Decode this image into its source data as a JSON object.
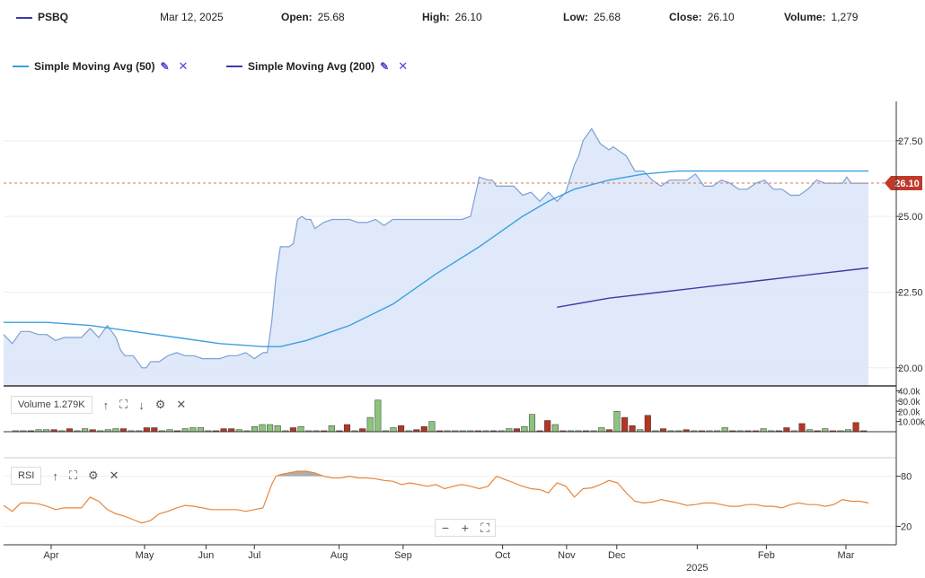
{
  "header": {
    "symbol": "PSBQ",
    "date": "Mar 12, 2025",
    "open_label": "Open:",
    "open_value": "25.68",
    "high_label": "High:",
    "high_value": "26.10",
    "low_label": "Low:",
    "low_value": "25.68",
    "close_label": "Close:",
    "close_value": "26.10",
    "volume_label": "Volume:",
    "volume_value": "1,279"
  },
  "legend": [
    {
      "label": "Simple Moving Avg (50)",
      "color": "#3aa0e0"
    },
    {
      "label": "Simple Moving Avg (200)",
      "color": "#3f3aa8"
    }
  ],
  "price_badge": "26.10",
  "volume_panel": {
    "label": "Volume 1.279K"
  },
  "rsi_panel": {
    "label": "RSI"
  },
  "colors": {
    "price_line": "#7f9fd6",
    "area_fill": "#dbe7f8",
    "sma50": "#3aa0e0",
    "sma200": "#3f3aa8",
    "up": "#8cc47c",
    "down": "#b73521",
    "rsi": "#e8863a",
    "badge": "#c0392b"
  },
  "chart_data": [
    {
      "type": "area",
      "title": "",
      "ylim": [
        19.4,
        28.8
      ],
      "y_ticks": [
        "20.00",
        "22.50",
        "25.00",
        "27.50"
      ],
      "x_ticks": [
        {
          "label": "Apr",
          "t": 0.055
        },
        {
          "label": "May",
          "t": 0.163
        },
        {
          "label": "Jun",
          "t": 0.234
        },
        {
          "label": "Jul",
          "t": 0.29
        },
        {
          "label": "Aug",
          "t": 0.388
        },
        {
          "label": "Sep",
          "t": 0.462
        },
        {
          "label": "Oct",
          "t": 0.577
        },
        {
          "label": "Nov",
          "t": 0.651
        },
        {
          "label": "Dec",
          "t": 0.709
        },
        {
          "label": "Feb",
          "t": 0.882
        },
        {
          "label": "Mar",
          "t": 0.974
        }
      ],
      "x_year_label": {
        "label": "2025",
        "t": 0.802
      },
      "reference_line": 26.1,
      "series": [
        {
          "name": "PSBQ",
          "t": [
            0,
            0.01,
            0.02,
            0.03,
            0.04,
            0.05,
            0.06,
            0.07,
            0.08,
            0.09,
            0.1,
            0.11,
            0.12,
            0.125,
            0.13,
            0.135,
            0.14,
            0.15,
            0.16,
            0.165,
            0.17,
            0.18,
            0.19,
            0.2,
            0.21,
            0.22,
            0.23,
            0.24,
            0.25,
            0.26,
            0.27,
            0.28,
            0.29,
            0.3,
            0.305,
            0.31,
            0.315,
            0.32,
            0.33,
            0.335,
            0.34,
            0.345,
            0.35,
            0.355,
            0.36,
            0.37,
            0.38,
            0.39,
            0.4,
            0.41,
            0.42,
            0.43,
            0.44,
            0.45,
            0.46,
            0.47,
            0.48,
            0.49,
            0.5,
            0.51,
            0.52,
            0.53,
            0.54,
            0.55,
            0.56,
            0.565,
            0.57,
            0.58,
            0.59,
            0.6,
            0.61,
            0.62,
            0.63,
            0.64,
            0.65,
            0.66,
            0.665,
            0.67,
            0.68,
            0.69,
            0.7,
            0.705,
            0.71,
            0.72,
            0.73,
            0.74,
            0.75,
            0.76,
            0.77,
            0.78,
            0.79,
            0.8,
            0.81,
            0.82,
            0.83,
            0.84,
            0.85,
            0.86,
            0.87,
            0.88,
            0.89,
            0.9,
            0.91,
            0.92,
            0.93,
            0.94,
            0.95,
            0.96,
            0.97,
            0.975,
            0.98,
            0.99,
            1.0
          ],
          "y": [
            21.1,
            20.8,
            21.2,
            21.2,
            21.1,
            21.1,
            20.9,
            21.0,
            21.0,
            21.0,
            21.3,
            21.0,
            21.4,
            21.2,
            21.0,
            20.6,
            20.4,
            20.4,
            20.0,
            20.0,
            20.2,
            20.2,
            20.4,
            20.5,
            20.4,
            20.4,
            20.3,
            20.3,
            20.3,
            20.4,
            20.4,
            20.5,
            20.3,
            20.5,
            20.5,
            21.5,
            23.0,
            24.0,
            24.0,
            24.1,
            24.9,
            25.0,
            24.9,
            24.9,
            24.6,
            24.8,
            24.9,
            24.9,
            24.9,
            24.8,
            24.8,
            24.9,
            24.7,
            24.9,
            24.9,
            24.9,
            24.9,
            24.9,
            24.9,
            24.9,
            24.9,
            24.9,
            25.0,
            26.3,
            26.2,
            26.2,
            26.0,
            26.0,
            26.0,
            25.7,
            25.8,
            25.5,
            25.8,
            25.5,
            25.8,
            26.7,
            27.0,
            27.5,
            27.9,
            27.4,
            27.2,
            27.3,
            27.2,
            27.0,
            26.5,
            26.5,
            26.2,
            26.0,
            26.2,
            26.2,
            26.2,
            26.4,
            26.0,
            26.0,
            26.2,
            26.1,
            25.9,
            25.9,
            26.1,
            26.2,
            25.9,
            25.9,
            25.7,
            25.7,
            25.9,
            26.2,
            26.1,
            26.1,
            26.1,
            26.3,
            26.1,
            26.1,
            26.1
          ]
        },
        {
          "name": "Simple Moving Avg (50)",
          "t": [
            0,
            0.05,
            0.1,
            0.15,
            0.2,
            0.25,
            0.3,
            0.32,
            0.35,
            0.4,
            0.45,
            0.5,
            0.55,
            0.6,
            0.63,
            0.66,
            0.7,
            0.74,
            0.78,
            0.82,
            0.85,
            0.88,
            0.9,
            0.95,
            1.0
          ],
          "y": [
            21.5,
            21.5,
            21.4,
            21.2,
            21.0,
            20.8,
            20.7,
            20.7,
            20.9,
            21.4,
            22.1,
            23.1,
            24.0,
            25.0,
            25.5,
            25.9,
            26.2,
            26.4,
            26.5,
            26.5,
            26.5,
            26.5,
            26.5,
            26.5,
            26.5
          ]
        },
        {
          "name": "Simple Moving Avg (200)",
          "t": [
            0.64,
            0.7,
            0.76,
            0.82,
            0.88,
            0.94,
            1.0
          ],
          "y": [
            22.0,
            22.3,
            22.5,
            22.7,
            22.9,
            23.1,
            23.3
          ]
        }
      ]
    },
    {
      "type": "bar",
      "title": "",
      "ylim": [
        0,
        44
      ],
      "y_ticks": [
        "10.00k",
        "20.0k",
        "30.0k",
        "40.0k"
      ],
      "values": [
        1,
        1,
        1,
        2,
        2,
        2,
        1,
        3,
        1,
        3,
        2,
        1,
        2,
        3,
        3,
        1,
        1,
        4,
        4,
        1,
        2,
        1,
        3,
        4,
        4,
        1,
        1,
        3,
        3,
        2,
        1,
        5,
        7,
        7,
        6,
        1,
        4,
        5,
        1,
        1,
        1,
        6,
        1,
        7,
        1,
        3,
        14,
        31,
        1,
        4,
        6,
        1,
        2,
        5,
        10,
        1,
        1,
        1,
        1,
        1,
        1,
        1,
        1,
        1,
        3,
        3,
        5,
        17,
        1,
        11,
        7,
        1,
        1,
        1,
        1,
        1,
        4,
        2,
        20,
        14,
        6,
        2,
        16,
        1,
        3,
        1,
        1,
        2,
        1,
        1,
        1,
        1,
        4,
        1,
        1,
        1,
        1,
        3,
        1,
        1,
        4,
        1,
        8,
        2,
        1,
        3,
        1,
        1,
        2,
        9,
        1
      ],
      "up": [
        true,
        true,
        false,
        true,
        true,
        false,
        true,
        false,
        true,
        true,
        false,
        true,
        true,
        true,
        false,
        true,
        true,
        false,
        false,
        true,
        true,
        false,
        true,
        true,
        true,
        true,
        false,
        false,
        false,
        true,
        true,
        true,
        true,
        true,
        true,
        true,
        false,
        true,
        true,
        true,
        false,
        true,
        false,
        false,
        true,
        false,
        true,
        true,
        true,
        true,
        false,
        true,
        false,
        false,
        true,
        false,
        true,
        true,
        true,
        true,
        false,
        true,
        false,
        true,
        true,
        false,
        true,
        true,
        false,
        false,
        true,
        false,
        true,
        true,
        false,
        true,
        true,
        false,
        true,
        false,
        false,
        true,
        false,
        true,
        false,
        true,
        true,
        false,
        true,
        false,
        true,
        true,
        true,
        false,
        true,
        false,
        false,
        true,
        true,
        false,
        false,
        true,
        false,
        true,
        false,
        true,
        false,
        true,
        true,
        false,
        false
      ]
    },
    {
      "type": "line",
      "title": "",
      "ylim": [
        0,
        100
      ],
      "y_ticks": [
        "20",
        "80"
      ],
      "series": [
        {
          "name": "RSI",
          "t": [
            0,
            0.01,
            0.02,
            0.03,
            0.04,
            0.05,
            0.06,
            0.07,
            0.08,
            0.09,
            0.1,
            0.11,
            0.12,
            0.13,
            0.14,
            0.15,
            0.16,
            0.17,
            0.18,
            0.19,
            0.2,
            0.21,
            0.22,
            0.23,
            0.24,
            0.25,
            0.26,
            0.27,
            0.28,
            0.29,
            0.3,
            0.31,
            0.315,
            0.32,
            0.33,
            0.34,
            0.35,
            0.36,
            0.37,
            0.38,
            0.39,
            0.4,
            0.41,
            0.42,
            0.43,
            0.44,
            0.45,
            0.46,
            0.47,
            0.48,
            0.49,
            0.5,
            0.51,
            0.52,
            0.53,
            0.54,
            0.55,
            0.56,
            0.57,
            0.58,
            0.59,
            0.6,
            0.61,
            0.62,
            0.63,
            0.64,
            0.65,
            0.66,
            0.67,
            0.68,
            0.69,
            0.7,
            0.71,
            0.72,
            0.73,
            0.74,
            0.75,
            0.76,
            0.77,
            0.78,
            0.79,
            0.8,
            0.81,
            0.82,
            0.83,
            0.84,
            0.85,
            0.86,
            0.87,
            0.88,
            0.89,
            0.9,
            0.91,
            0.92,
            0.93,
            0.94,
            0.95,
            0.96,
            0.97,
            0.98,
            0.99,
            1.0
          ],
          "y": [
            45,
            38,
            48,
            48,
            47,
            44,
            40,
            42,
            42,
            42,
            55,
            50,
            40,
            35,
            32,
            28,
            24,
            27,
            35,
            38,
            42,
            45,
            44,
            42,
            40,
            40,
            40,
            40,
            38,
            40,
            42,
            70,
            80,
            82,
            84,
            86,
            86,
            84,
            80,
            78,
            78,
            80,
            78,
            78,
            77,
            75,
            74,
            70,
            72,
            70,
            68,
            70,
            65,
            68,
            70,
            68,
            65,
            68,
            80,
            76,
            72,
            68,
            65,
            64,
            60,
            72,
            68,
            55,
            65,
            66,
            70,
            75,
            72,
            60,
            50,
            48,
            49,
            52,
            50,
            48,
            45,
            46,
            48,
            48,
            46,
            44,
            44,
            46,
            46,
            44,
            44,
            42,
            46,
            48,
            46,
            46,
            44,
            46,
            52,
            50,
            50,
            48
          ]
        }
      ],
      "shaded_above": 80
    }
  ]
}
